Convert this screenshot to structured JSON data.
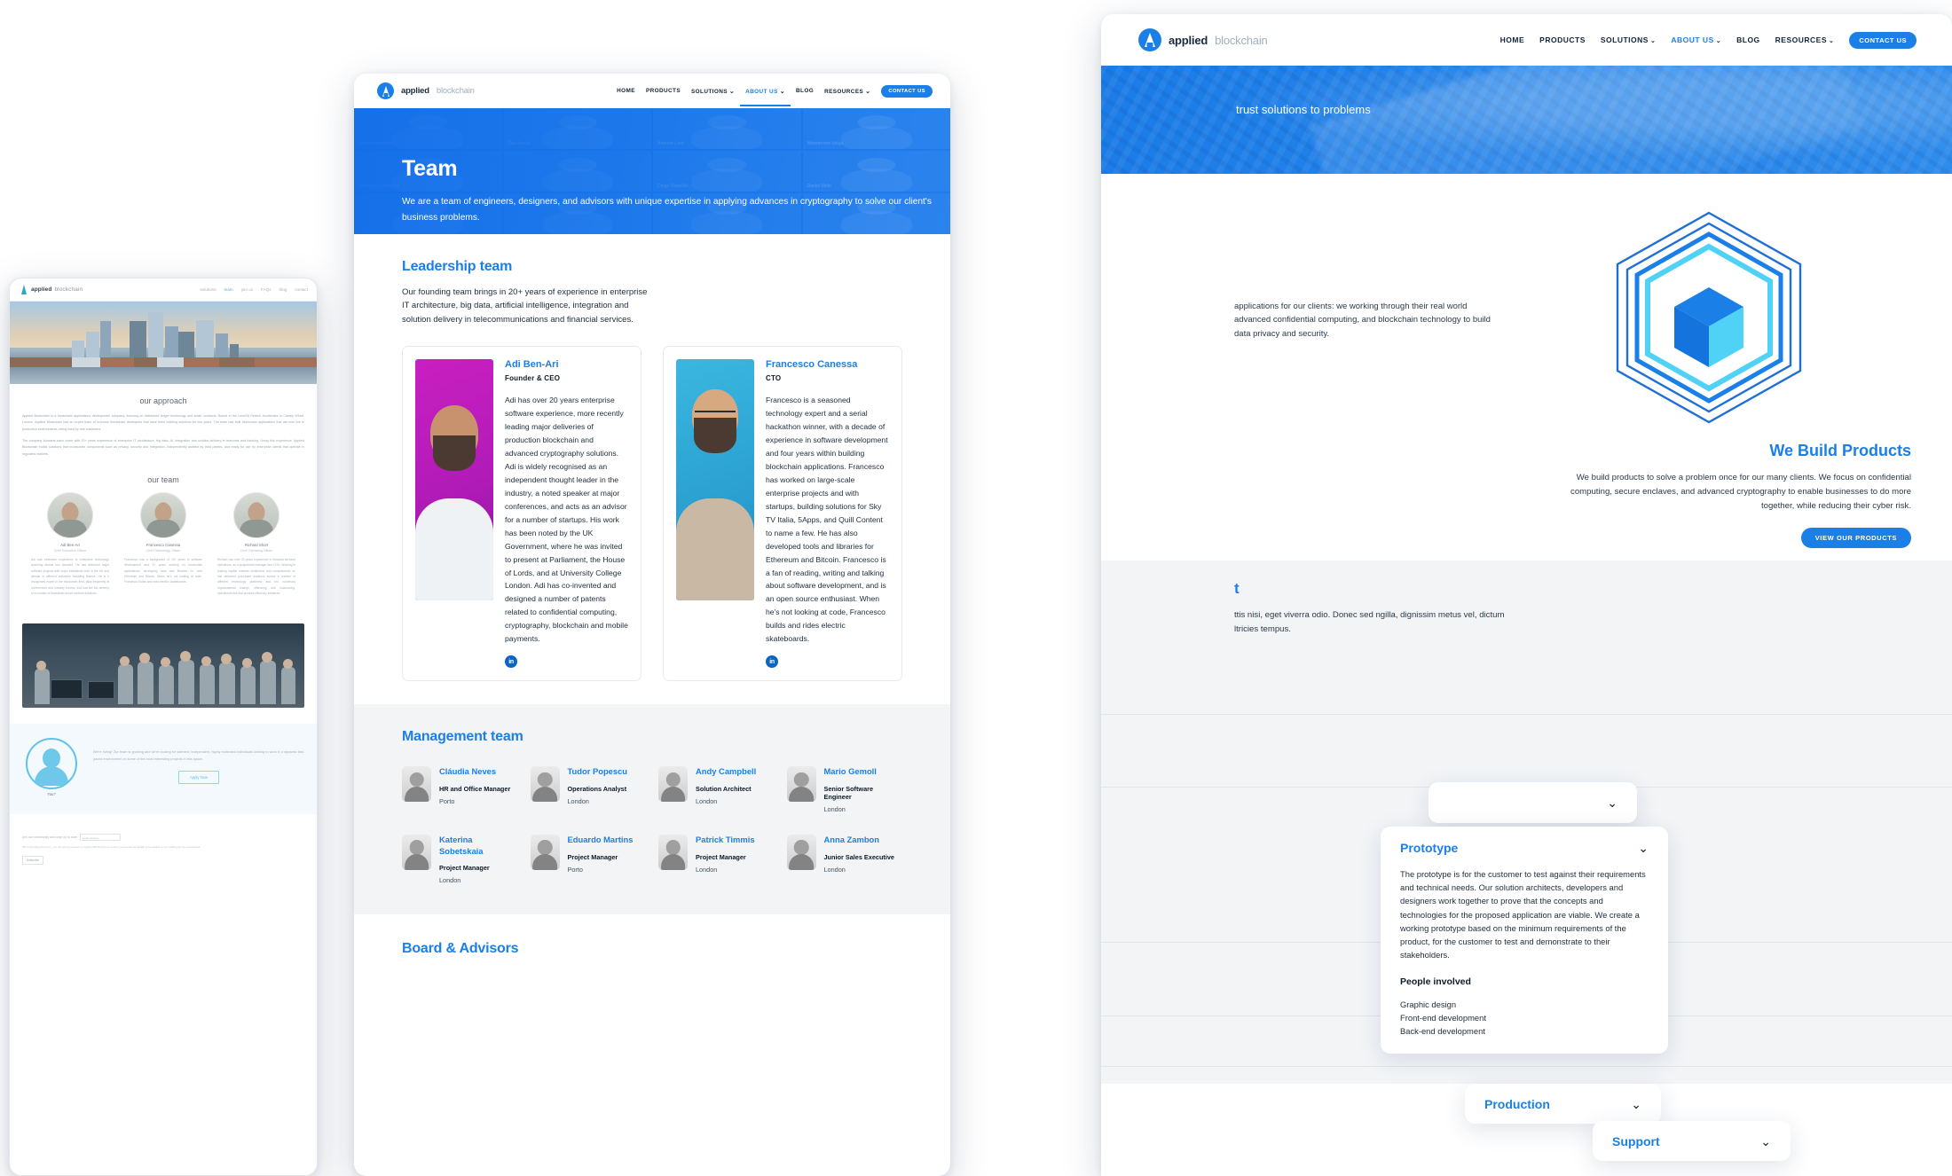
{
  "brand": {
    "name_bold": "applied",
    "name_light": "blockchain",
    "accent": "#1b7fe8"
  },
  "window_legacy": {
    "nav": [
      "solutions",
      "team",
      "join us",
      "FAQs",
      "blog",
      "contact"
    ],
    "nav_active": "team",
    "approach_title": "our approach",
    "approach_p1": "Applied Blockchain is a blockchain applications development company, focusing on distributed ledger technology and smart contracts. Based in the Level39 Fintech Accelerator in Canary Wharf, London, Applied Blockchain has an expert team of in-house blockchain developers that have been building solutions for two years. The team has built blockchain applications that are now live in production environments, being used by real customers.",
    "approach_p2": "The company founders each come with 20+ years experience of enterprise IT architecture, big data, AI, integration and solution delivery in telecoms and banking. Using this experience, Applied Blockchain builds solutions that incorporate components such as privacy, security and integration, independently audited by third parties, and ready for use by enterprise clients that operate in regulated markets.",
    "team_title": "our team",
    "team": [
      {
        "name": "Adi Ben-Ari",
        "role": "Chief Executive Officer",
        "bio": "Adi has extensive experience in enterprise technology spanning almost two decades. He has delivered major software projects with major institutions both in the UK and abroad in different industries including finance. He is a recognised expert in the blockchain field, talks frequently at conferences and industry forums, and has led the delivery of a number of blockchain smart contract solutions."
      },
      {
        "name": "Francesco Canessa",
        "role": "Chief Technology Officer",
        "bio": "Francesco has a background of 10+ years in software development and 4+ years working on blockchain applications, developing tools and libraries for both Ethereum and Bitcoin. When he's not looking at code, Francesco builds and rides electric skateboards."
      },
      {
        "name": "Richard Short",
        "role": "Chief Operating Officer",
        "bio": "Richard has over 20 years experience in financial services operations, as a programme manager and COO. Working in leading capital markets institutions and consultancies he has delivered post-trade solutions across a number of different technology platforms and led numerous organisational change, offshoring and outsourcing, operational risk and process efficiency initiatives."
      }
    ],
    "hiring_text": "We're hiring! Our team is growing and we're looking for talented, independent, highly motivated individuals looking to work in a dynamic fast-paced environment on some of the most interesting projects in this space.",
    "hiring_avatar_label": "You?",
    "apply_button": "Apply Now",
    "subscribe_label": "join our community and stay up to date",
    "subscribe_placeholder": "email address",
    "subscribe_fine": "*By submitting this form, you are giving consent to Applied Blockchain to collect your personal details to be added to our mailing list for newsletters.",
    "subscribe_button": "Subscribe"
  },
  "window_team": {
    "nav": [
      {
        "label": "HOME",
        "caret": false,
        "active": false
      },
      {
        "label": "PRODUCTS",
        "caret": false,
        "active": false
      },
      {
        "label": "SOLUTIONS",
        "caret": true,
        "active": false
      },
      {
        "label": "ABOUT US",
        "caret": true,
        "active": true
      },
      {
        "label": "BLOG",
        "caret": false,
        "active": false
      },
      {
        "label": "RESOURCES",
        "caret": true,
        "active": false
      }
    ],
    "cta": "CONTACT US",
    "hero_title": "Team",
    "hero_text": "We are a team of engineers, designers, and advisors with unique expertise in applying advances in cryptography to solve our client's business problems.",
    "hero_participants": [
      "Maria Fernandes",
      "Dan Araujo",
      "Andrew Lord",
      "Wanderson Veiga",
      "Katerina Sobetskaia",
      "Diogo Brandão",
      "Daniel Melo"
    ],
    "leadership_title": "Leadership team",
    "leadership_sub": "Our founding team brings in 20+ years of experience in enterprise IT architecture, big data, artificial intelligence, integration and solution delivery in telecommunications and financial services.",
    "leaders": [
      {
        "name": "Adi Ben-Ari",
        "role": "Founder & CEO",
        "bio": "Adi has over 20 years enterprise software experience, more recently leading major deliveries of production blockchain and advanced cryptography solutions. Adi is widely recognised as an independent thought leader in the industry, a noted speaker at major conferences, and acts as an advisor for a number of startups. His work has been noted by the UK Government, where he was invited to present at Parliament, the House of Lords, and at University College London. Adi has co-invented and designed a number of patents related to confidential computing, cryptography, blockchain and mobile payments.",
        "linkedin": "in"
      },
      {
        "name": "Francesco Canessa",
        "role": "CTO",
        "bio": "Francesco is a seasoned technology expert and a serial hackathon winner, with a decade of experience in software development and four years within building blockchain applications. Francesco has worked on large-scale enterprise projects and with startups, building solutions for Sky TV Italia, 5Apps, and Quill Content to name a few. He has also developed tools and libraries for Ethereum and Bitcoin. Francesco is a fan of reading, writing and talking about software development, and is an open source enthusiast. When he's not looking at code, Francesco builds and rides electric skateboards.",
        "linkedin": "in"
      }
    ],
    "management_title": "Management team",
    "management": [
      {
        "name": "Cláudia Neves",
        "role": "HR and Office Manager",
        "location": "Porto"
      },
      {
        "name": "Tudor Popescu",
        "role": "Operations Analyst",
        "location": "London"
      },
      {
        "name": "Andy Campbell",
        "role": "Solution Architect",
        "location": "London"
      },
      {
        "name": "Mario Gemoll",
        "role": "Senior Software Engineer",
        "location": "London"
      },
      {
        "name": "Katerina Sobetskaia",
        "role": "Project Manager",
        "location": "London"
      },
      {
        "name": "Eduardo Martins",
        "role": "Project Manager",
        "location": "Porto"
      },
      {
        "name": "Patrick Timmis",
        "role": "Project Manager",
        "location": "London"
      },
      {
        "name": "Anna Zambon",
        "role": "Junior Sales Executive",
        "location": "London"
      }
    ],
    "board_title": "Board & Advisors"
  },
  "window_products": {
    "nav": [
      {
        "label": "HOME",
        "caret": false,
        "active": false
      },
      {
        "label": "PRODUCTS",
        "caret": false,
        "active": false
      },
      {
        "label": "SOLUTIONS",
        "caret": true,
        "active": false
      },
      {
        "label": "ABOUT US",
        "caret": true,
        "active": true
      },
      {
        "label": "BLOG",
        "caret": false,
        "active": false
      },
      {
        "label": "RESOURCES",
        "caret": true,
        "active": false
      }
    ],
    "cta": "CONTACT US",
    "hero_tail": "trust solutions to problems",
    "intro_text": "applications for our clients: we working through their real world advanced confidential computing, and blockchain technology to build data privacy and security.",
    "products_title": "We Build Products",
    "products_text": "We build products to solve a problem once for our many clients. We focus on confidential computing, secure enclaves, and advanced cryptography to enable businesses to do more together, while reducing their cyber risk.",
    "products_button": "VIEW OUR PRODUCTS",
    "lower_title_tail": "t",
    "lower_text": "ttis nisi, eget viverra odio. Donec sed ngilla, dignissim metus vel, dictum ltricies tempus.",
    "accordion": [
      {
        "id": "collapsed-top",
        "title": "",
        "open": false,
        "chevron": "⌄"
      },
      {
        "id": "prototype",
        "title": "Prototype",
        "open": true,
        "chevron": "⌄",
        "body": "The prototype is for the customer to test against their requirements and technical needs. Our solution architects, developers and designers work together to prove that the concepts and technologies for the proposed application are viable. We create a working prototype based on the minimum requirements of the product, for the customer to test and demonstrate to their stakeholders.",
        "people_title": "People involved",
        "people": [
          "Graphic design",
          "Front-end development",
          "Back-end development"
        ]
      },
      {
        "id": "production",
        "title": "Production",
        "open": false,
        "chevron": "⌄"
      },
      {
        "id": "support",
        "title": "Support",
        "open": false,
        "chevron": "⌄"
      }
    ]
  }
}
